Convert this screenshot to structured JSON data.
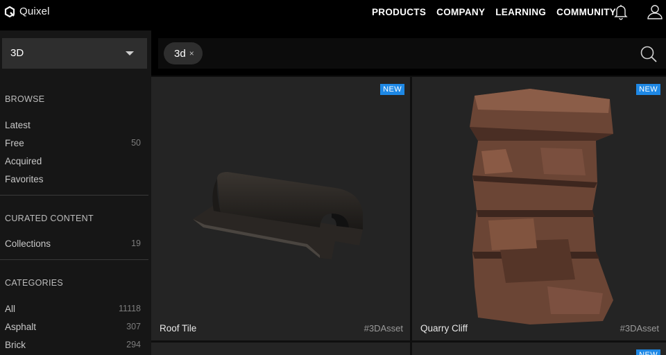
{
  "brand": {
    "name": "Quixel",
    "accent": "#1e88e5"
  },
  "nav": {
    "items": [
      "PRODUCTS",
      "COMPANY",
      "LEARNING",
      "COMMUNITY"
    ],
    "icons": [
      "bell-icon",
      "user-icon"
    ]
  },
  "filter": {
    "selected": "3D"
  },
  "search": {
    "chip": "3d",
    "chip_remove": "×"
  },
  "sidebar": {
    "browse": {
      "title": "BROWSE",
      "items": [
        {
          "label": "Latest",
          "count": ""
        },
        {
          "label": "Free",
          "count": "50"
        },
        {
          "label": "Acquired",
          "count": ""
        },
        {
          "label": "Favorites",
          "count": ""
        }
      ]
    },
    "curated": {
      "title": "CURATED CONTENT",
      "items": [
        {
          "label": "Collections",
          "count": "19"
        }
      ]
    },
    "categories": {
      "title": "CATEGORIES",
      "items": [
        {
          "label": "All",
          "count": "11118"
        },
        {
          "label": "Asphalt",
          "count": "307"
        },
        {
          "label": "Brick",
          "count": "294"
        }
      ]
    }
  },
  "assets": [
    {
      "name": "Roof Tile",
      "tag": "#3DAsset",
      "badge": "NEW"
    },
    {
      "name": "Quarry Cliff",
      "tag": "#3DAsset",
      "badge": "NEW"
    },
    {
      "badge": "NEW"
    }
  ]
}
